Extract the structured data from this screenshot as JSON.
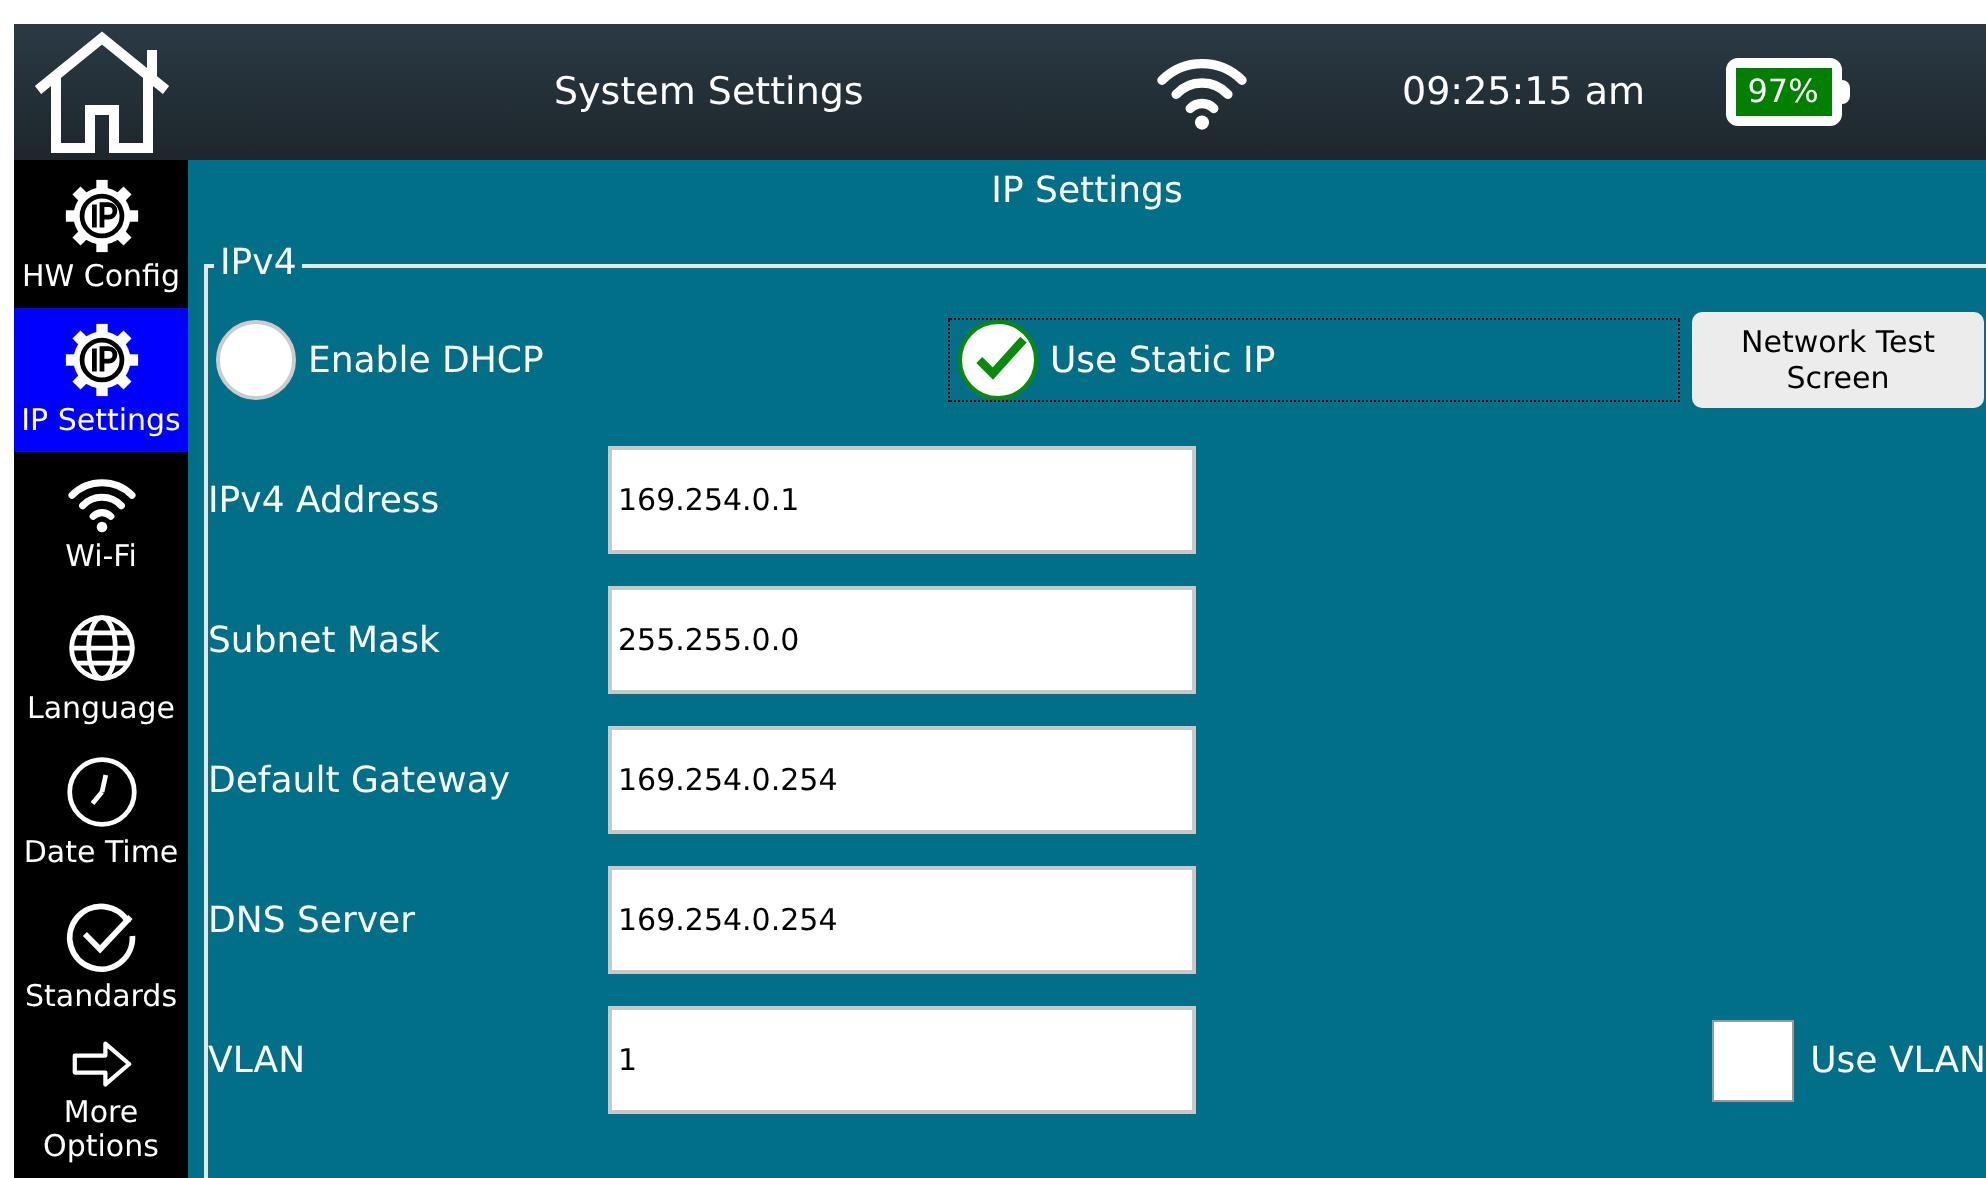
{
  "header": {
    "title": "System Settings",
    "time": "09:25:15 am",
    "battery": "97%"
  },
  "sidebar": {
    "items": [
      {
        "label": "HW Config",
        "kind": "hardware",
        "selected": false
      },
      {
        "label": "IP Settings",
        "kind": "network",
        "selected": true
      },
      {
        "label": "Wi-Fi",
        "kind": "wireless",
        "selected": false
      },
      {
        "label": "Language",
        "kind": "language",
        "selected": false
      },
      {
        "label": "Date Time",
        "kind": "datetime",
        "selected": false
      },
      {
        "label": "Standards",
        "kind": "standards",
        "selected": false
      },
      {
        "label": "More Options",
        "kind": "more",
        "selected": false
      }
    ]
  },
  "page_title": "IP Settings",
  "group": {
    "legend": "IPv4",
    "modes": [
      {
        "label": "Enable DHCP",
        "selected": false
      },
      {
        "label": "Use Static IP",
        "selected": true
      }
    ],
    "network_test_button": "Network Test Screen",
    "fields": [
      {
        "label": "IPv4 Address",
        "value": "169.254.0.1"
      },
      {
        "label": "Subnet Mask",
        "value": "255.255.0.0"
      },
      {
        "label": "Default Gateway",
        "value": "169.254.0.254"
      },
      {
        "label": "DNS Server",
        "value": "169.254.0.254"
      },
      {
        "label": "VLAN",
        "value": "1"
      }
    ],
    "use_vlan": {
      "label": "Use VLAN",
      "checked": false
    }
  }
}
